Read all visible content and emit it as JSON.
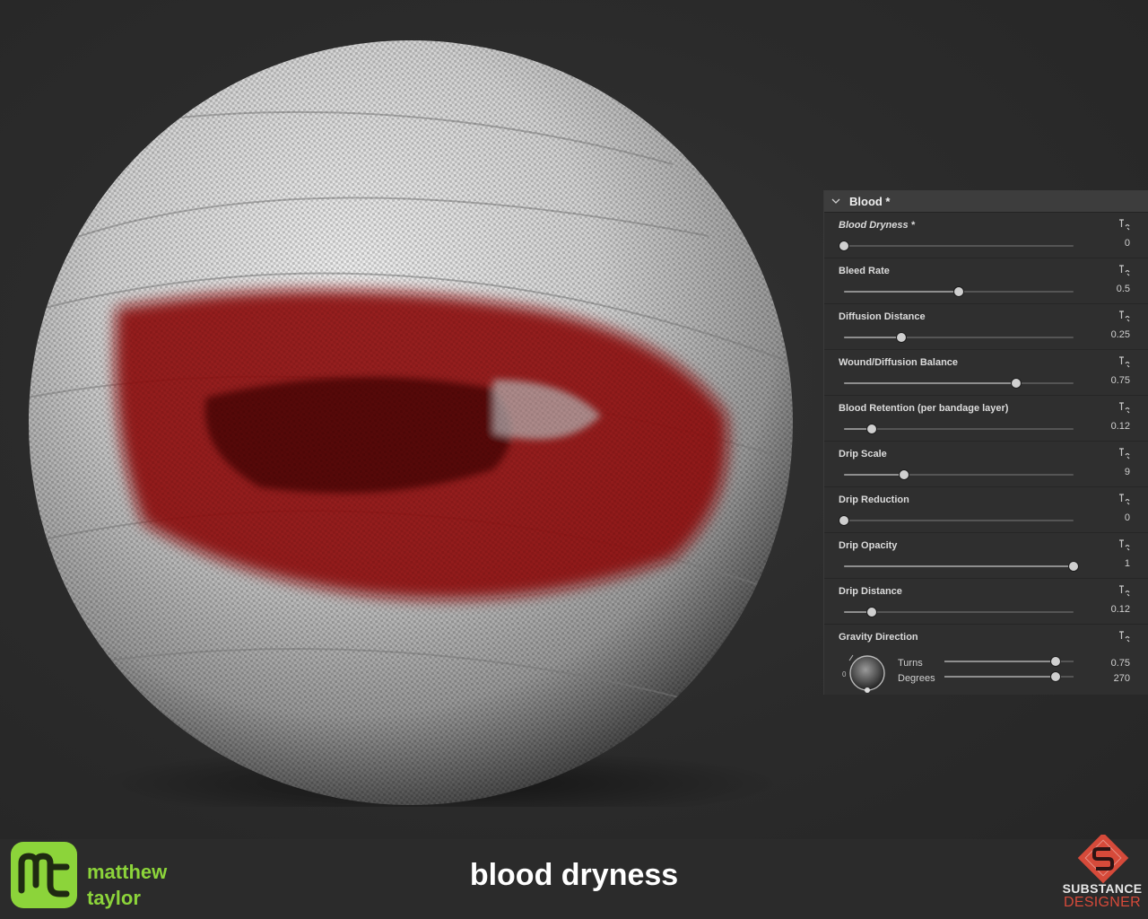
{
  "panel": {
    "group_title": "Blood *",
    "params": [
      {
        "label": "Blood Dryness *",
        "value": "0",
        "fraction": 0.0,
        "italic": true
      },
      {
        "label": "Bleed Rate",
        "value": "0.5",
        "fraction": 0.5
      },
      {
        "label": "Diffusion Distance",
        "value": "0.25",
        "fraction": 0.25
      },
      {
        "label": "Wound/Diffusion Balance",
        "value": "0.75",
        "fraction": 0.75
      },
      {
        "label": "Blood Retention (per bandage layer)",
        "value": "0.12",
        "fraction": 0.12
      },
      {
        "label": "Drip Scale",
        "value": "9",
        "fraction": 0.26
      },
      {
        "label": "Drip Reduction",
        "value": "0",
        "fraction": 0.0
      },
      {
        "label": "Drip Opacity",
        "value": "1",
        "fraction": 1.0
      },
      {
        "label": "Drip Distance",
        "value": "0.12",
        "fraction": 0.12
      }
    ],
    "gravity": {
      "label": "Gravity Direction",
      "dial_zero": "0",
      "turns_label": "Turns",
      "turns_value": "0.75",
      "turns_fraction": 0.86,
      "degrees_label": "Degrees",
      "degrees_value": "270",
      "degrees_fraction": 0.86
    }
  },
  "branding": {
    "author_line1": "matthew",
    "author_line2": "taylor",
    "caption": "blood dryness",
    "sd_line1": "SUBSTANCE",
    "sd_line2": "DESIGNER",
    "author_color": "#8cd43a",
    "sd_color": "#d64a3a",
    "blood_color": "#8e0d12"
  }
}
